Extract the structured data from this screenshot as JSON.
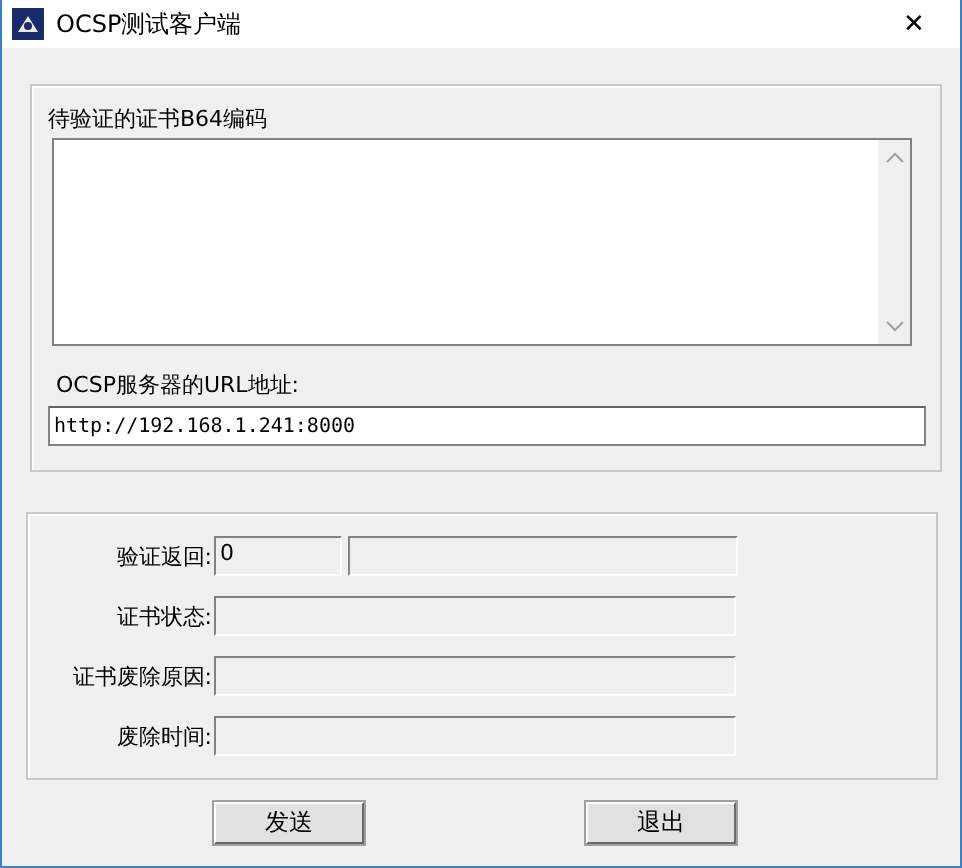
{
  "window": {
    "title": "OCSP测试客户端",
    "close": "✕"
  },
  "certificate": {
    "label": "待验证的证书B64编码"
  },
  "server": {
    "label": "OCSP服务器的URL地址:",
    "value": "http://192.168.1.241:8000"
  },
  "results": [
    {
      "label": "验证返回:",
      "value": "0",
      "split": true
    },
    {
      "label": "证书状态:",
      "split": false
    },
    {
      "label": "证书废除原因:",
      "split": false
    },
    {
      "label": "废除时间:",
      "split": false
    }
  ],
  "buttons": [
    "发送",
    "退出"
  ]
}
